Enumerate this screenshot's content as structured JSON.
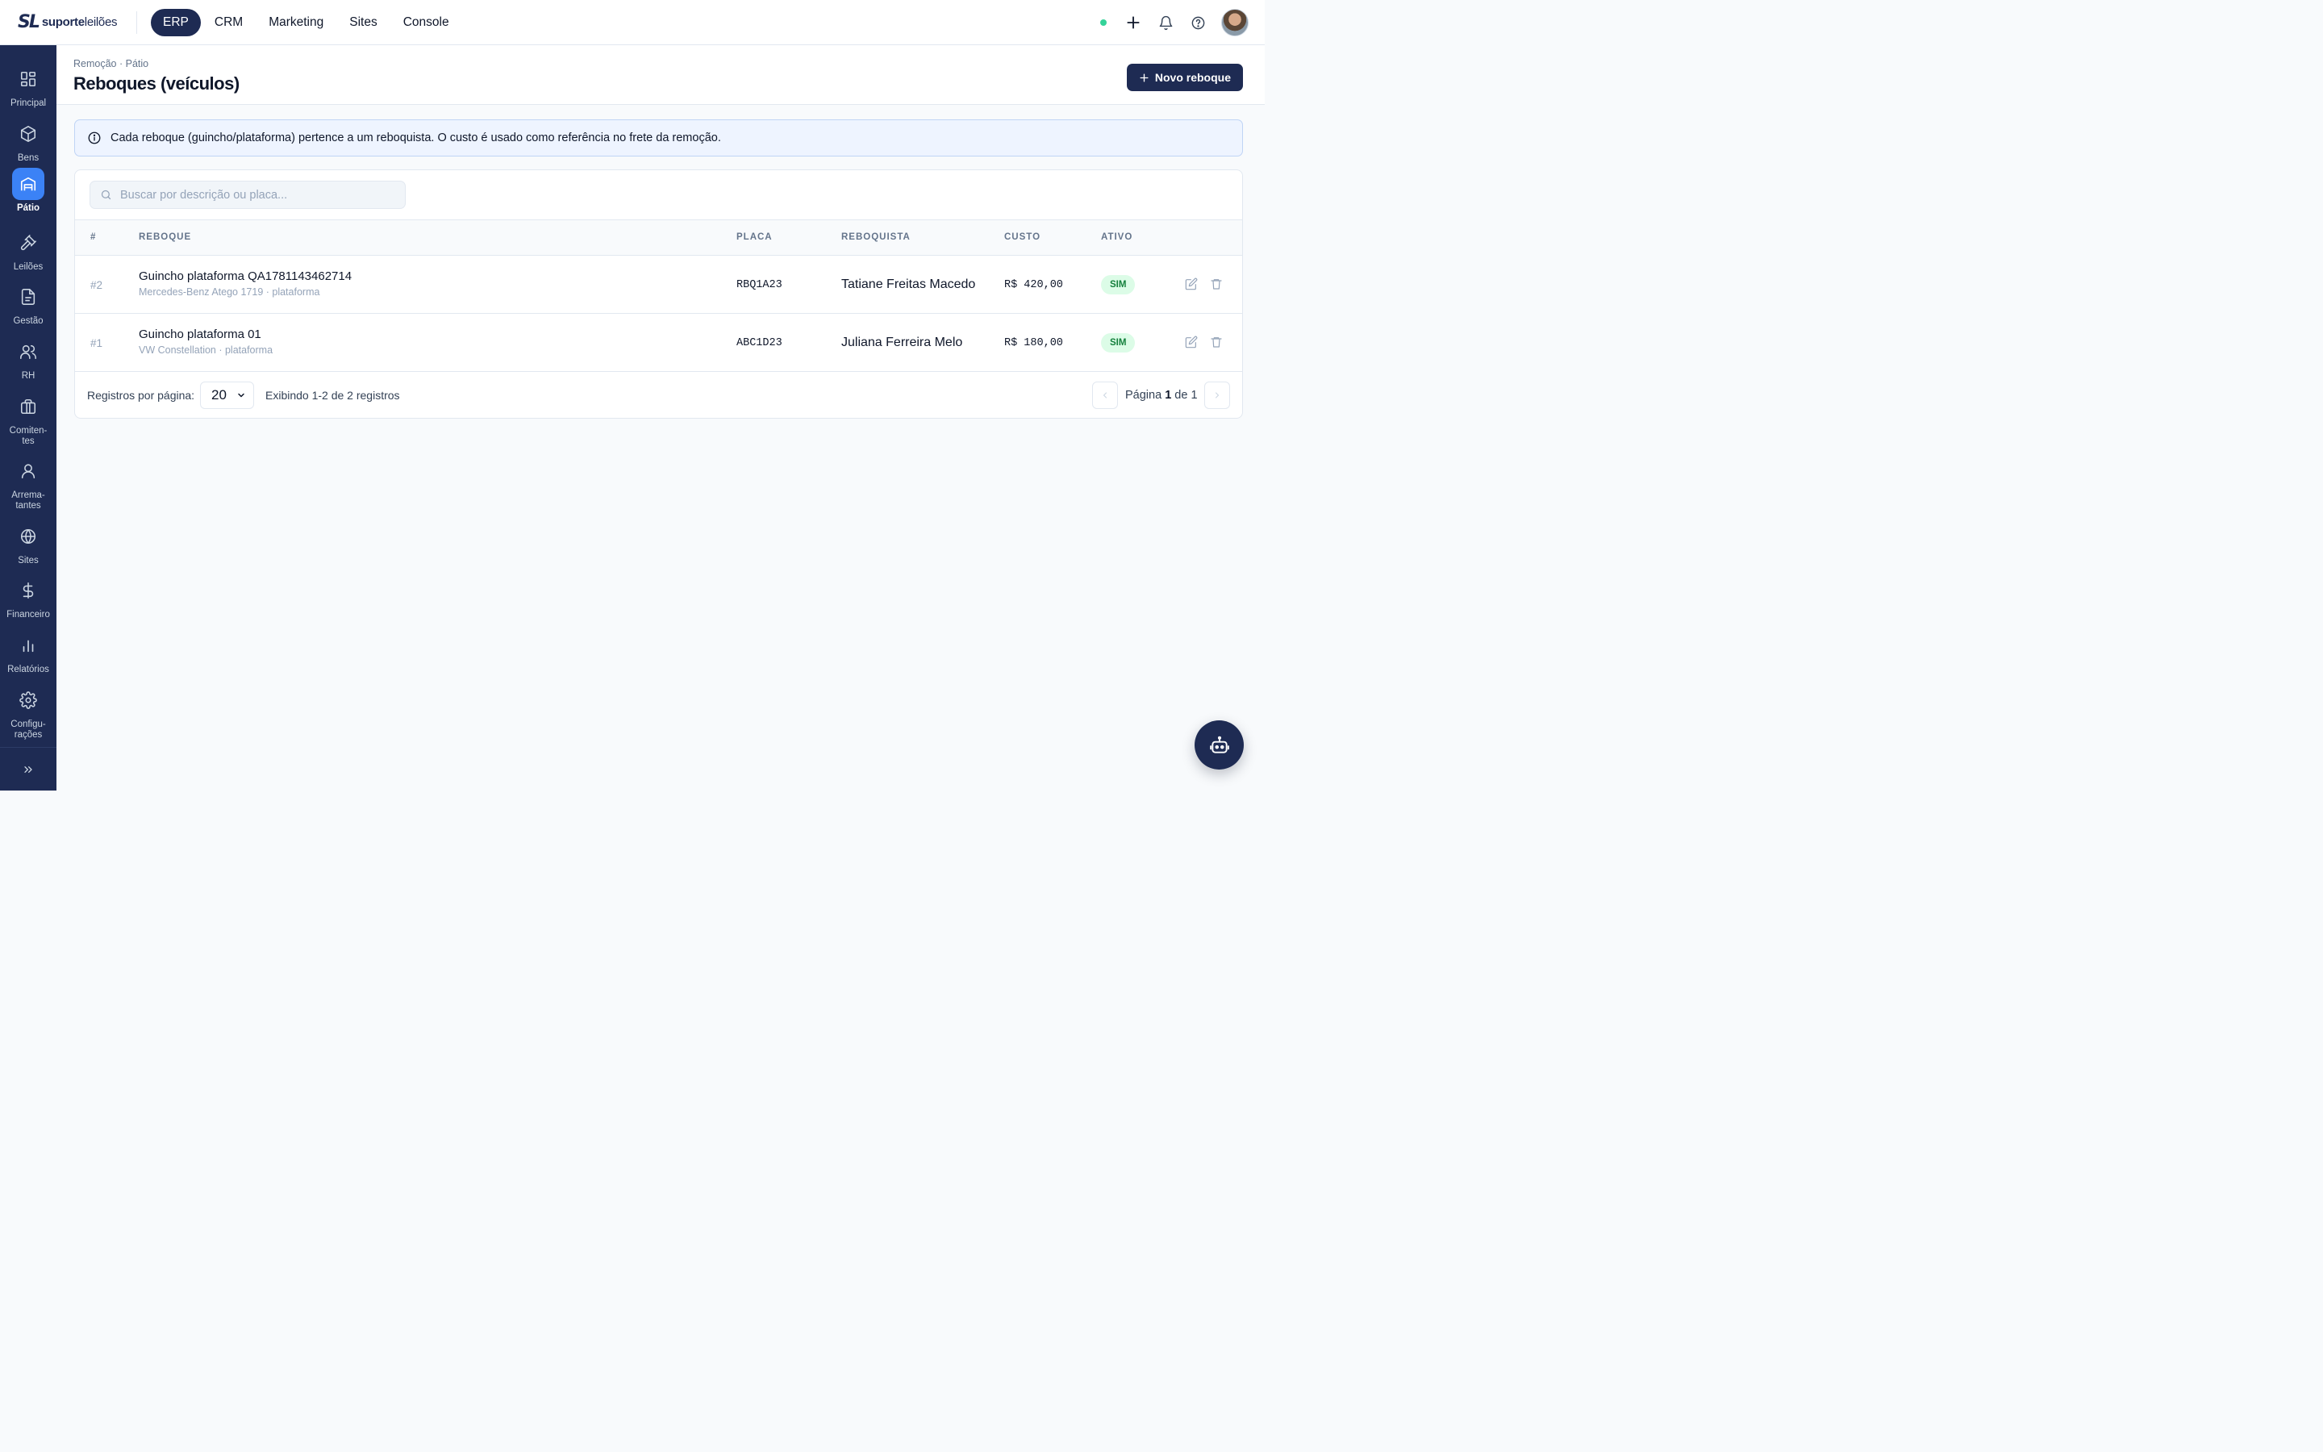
{
  "brand": {
    "mark": "SL",
    "name_bold": "suporte",
    "name_rest": "leilões"
  },
  "topnav": {
    "items": [
      {
        "label": "ERP",
        "active": true
      },
      {
        "label": "CRM"
      },
      {
        "label": "Marketing"
      },
      {
        "label": "Sites"
      },
      {
        "label": "Console"
      }
    ]
  },
  "top_actions": {
    "status_color": "#34d399",
    "icons": [
      "plus-icon",
      "bell-icon",
      "help-icon",
      "avatar"
    ]
  },
  "sidebar": {
    "items": [
      {
        "label": "Principal",
        "icon": "grid-icon"
      },
      {
        "label": "Bens",
        "icon": "box-icon"
      },
      {
        "label": "Pátio",
        "icon": "warehouse-icon",
        "active": true
      },
      {
        "label": "Leilões",
        "icon": "gavel-icon"
      },
      {
        "label": "Gestão",
        "icon": "file-icon"
      },
      {
        "label": "RH",
        "icon": "users-icon"
      },
      {
        "label": "Comiten-\ntes",
        "icon": "briefcase-icon"
      },
      {
        "label": "Arrema-\ntantes",
        "icon": "user-icon"
      },
      {
        "label": "Sites",
        "icon": "globe-icon"
      },
      {
        "label": "Financeiro",
        "icon": "dollar-icon"
      },
      {
        "label": "Relatórios",
        "icon": "bar-chart-icon"
      },
      {
        "label": "Configu-\nrações",
        "icon": "gear-icon"
      }
    ]
  },
  "header": {
    "breadcrumb": "Remoção · Pátio",
    "title": "Reboques (veículos)",
    "new_button": "Novo reboque"
  },
  "info_banner": "Cada reboque (guincho/plataforma) pertence a um reboquista. O custo é usado como referência no frete da remoção.",
  "search": {
    "placeholder": "Buscar por descrição ou placa...",
    "value": ""
  },
  "table": {
    "columns": [
      "#",
      "REBOQUE",
      "PLACA",
      "REBOQUISTA",
      "CUSTO",
      "ATIVO"
    ],
    "rows": [
      {
        "id": "#2",
        "name": "Guincho plataforma QA1781143462714",
        "sub": "Mercedes-Benz Atego 1719 · plataforma",
        "plate": "RBQ1A23",
        "owner": "Tatiane Freitas Macedo",
        "cost": "R$ 420,00",
        "active": "SIM"
      },
      {
        "id": "#1",
        "name": "Guincho plataforma 01",
        "sub": "VW Constellation · plataforma",
        "plate": "ABC1D23",
        "owner": "Juliana Ferreira Melo",
        "cost": "R$ 180,00",
        "active": "SIM"
      }
    ]
  },
  "pagination": {
    "per_page_label": "Registros por página:",
    "per_page": "20",
    "summary": "Exibindo 1-2 de 2 registros",
    "page_prefix": "Página",
    "page": "1",
    "page_mid": "de",
    "total_pages": "1"
  },
  "colors": {
    "navy": "#1e2b53",
    "accent": "#3b82f6",
    "success_bg": "#dcfce7",
    "success_text": "#15803d",
    "info_bg": "#eef4ff"
  }
}
